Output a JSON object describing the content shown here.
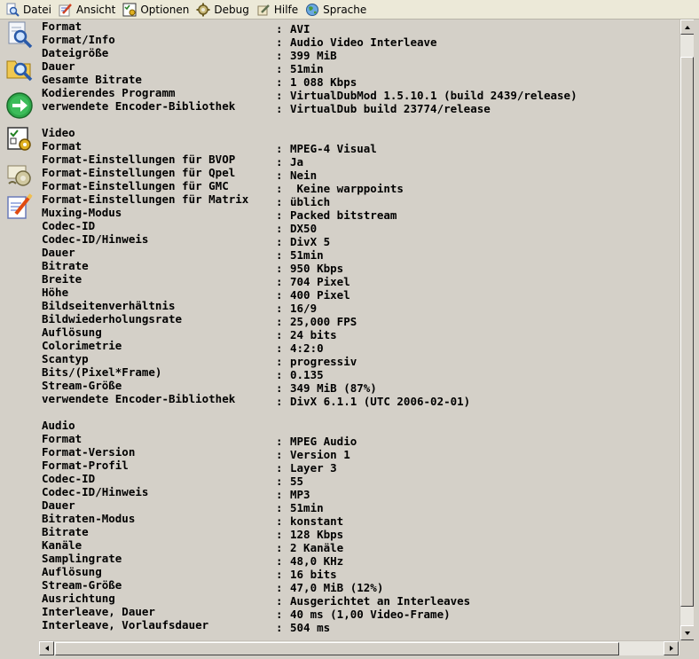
{
  "menu": {
    "items": [
      {
        "label": "Datei",
        "icon": "magnifier-document-icon"
      },
      {
        "label": "Ansicht",
        "icon": "pencil-edit-icon"
      },
      {
        "label": "Optionen",
        "icon": "options-checklist-icon"
      },
      {
        "label": "Debug",
        "icon": "debug-gear-icon"
      },
      {
        "label": "Hilfe",
        "icon": "help-pencil-icon"
      },
      {
        "label": "Sprache",
        "icon": "globe-icon"
      }
    ]
  },
  "sidebar": {
    "buttons": [
      {
        "name": "open-file-icon"
      },
      {
        "name": "open-folder-icon"
      },
      {
        "name": "next-arrow-icon"
      },
      {
        "name": "options-icon"
      },
      {
        "name": "debug-icon"
      },
      {
        "name": "edit-notes-icon"
      }
    ]
  },
  "info": {
    "lines": [
      {
        "k": "Format",
        "v": "AVI"
      },
      {
        "k": "Format/Info",
        "v": "Audio Video Interleave"
      },
      {
        "k": "Dateigröße",
        "v": "399 MiB"
      },
      {
        "k": "Dauer",
        "v": "51min"
      },
      {
        "k": "Gesamte Bitrate",
        "v": "1 088 Kbps"
      },
      {
        "k": "Kodierendes Programm",
        "v": "VirtualDubMod 1.5.10.1 (build 2439/release)"
      },
      {
        "k": "verwendete Encoder-Bibliothek",
        "v": "VirtualDub build 23774/release"
      },
      {
        "k": "",
        "v": ""
      },
      {
        "k": "Video",
        "v": ""
      },
      {
        "k": "Format",
        "v": "MPEG-4 Visual"
      },
      {
        "k": "Format-Einstellungen für BVOP",
        "v": "Ja"
      },
      {
        "k": "Format-Einstellungen für Qpel",
        "v": "Nein"
      },
      {
        "k": "Format-Einstellungen für GMC",
        "v": " Keine warppoints"
      },
      {
        "k": "Format-Einstellungen für Matrix",
        "v": "üblich"
      },
      {
        "k": "Muxing-Modus",
        "v": "Packed bitstream"
      },
      {
        "k": "Codec-ID",
        "v": "DX50"
      },
      {
        "k": "Codec-ID/Hinweis",
        "v": "DivX 5"
      },
      {
        "k": "Dauer",
        "v": "51min"
      },
      {
        "k": "Bitrate",
        "v": "950 Kbps"
      },
      {
        "k": "Breite",
        "v": "704 Pixel"
      },
      {
        "k": "Höhe",
        "v": "400 Pixel"
      },
      {
        "k": "Bildseitenverhältnis",
        "v": "16/9"
      },
      {
        "k": "Bildwiederholungsrate",
        "v": "25,000 FPS"
      },
      {
        "k": "Auflösung",
        "v": "24 bits"
      },
      {
        "k": "Colorimetrie",
        "v": "4:2:0"
      },
      {
        "k": "Scantyp",
        "v": "progressiv"
      },
      {
        "k": "Bits/(Pixel*Frame)",
        "v": "0.135"
      },
      {
        "k": "Stream-Größe",
        "v": "349 MiB (87%)"
      },
      {
        "k": "verwendete Encoder-Bibliothek",
        "v": "DivX 6.1.1 (UTC 2006-02-01)"
      },
      {
        "k": "",
        "v": ""
      },
      {
        "k": "Audio",
        "v": ""
      },
      {
        "k": "Format",
        "v": "MPEG Audio"
      },
      {
        "k": "Format-Version",
        "v": "Version 1"
      },
      {
        "k": "Format-Profil",
        "v": "Layer 3"
      },
      {
        "k": "Codec-ID",
        "v": "55"
      },
      {
        "k": "Codec-ID/Hinweis",
        "v": "MP3"
      },
      {
        "k": "Dauer",
        "v": "51min"
      },
      {
        "k": "Bitraten-Modus",
        "v": "konstant"
      },
      {
        "k": "Bitrate",
        "v": "128 Kbps"
      },
      {
        "k": "Kanäle",
        "v": "2 Kanäle"
      },
      {
        "k": "Samplingrate",
        "v": "48,0 KHz"
      },
      {
        "k": "Auflösung",
        "v": "16 bits"
      },
      {
        "k": "Stream-Größe",
        "v": "47,0 MiB (12%)"
      },
      {
        "k": "Ausrichtung",
        "v": "Ausgerichtet an Interleaves"
      },
      {
        "k": "Interleave, Dauer",
        "v": "40 ms (1,00 Video-Frame)"
      },
      {
        "k": "Interleave, Vorlaufsdauer",
        "v": "504 ms"
      }
    ]
  }
}
